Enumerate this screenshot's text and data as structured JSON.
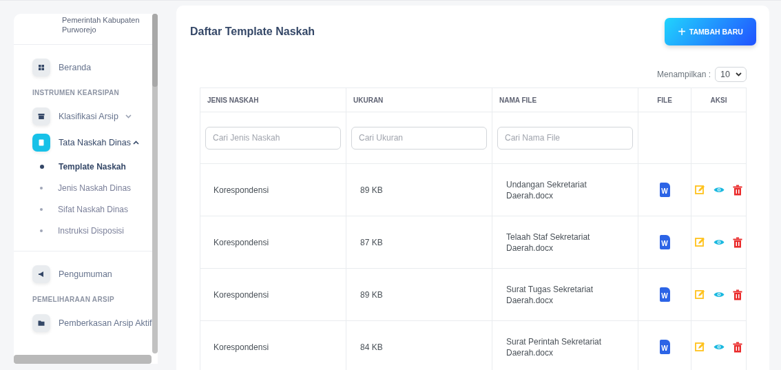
{
  "sidebar": {
    "org_name": [
      "Pemerintah Kabupaten",
      "Purworejo"
    ],
    "items": [
      {
        "kind": "link",
        "label": "Beranda",
        "selected": false
      },
      {
        "kind": "heading",
        "label": "INSTRUMEN KEARSIPAN"
      },
      {
        "kind": "group",
        "label": "Klasifikasi Arsip",
        "selected": false,
        "expanded": false
      },
      {
        "kind": "group",
        "label": "Tata Naskah Dinas",
        "selected": true,
        "expanded": true,
        "children": [
          {
            "label": "Template Naskah",
            "selected": true
          },
          {
            "label": "Jenis Naskah Dinas",
            "selected": false
          },
          {
            "label": "Sifat Naskah Dinas",
            "selected": false
          },
          {
            "label": "Instruksi Disposisi",
            "selected": false
          }
        ]
      },
      {
        "kind": "divider"
      },
      {
        "kind": "link",
        "label": "Pengumuman",
        "selected": false
      },
      {
        "kind": "heading",
        "label": "PEMELIHARAAN ARSIP"
      },
      {
        "kind": "link",
        "label": "Pemberkasan Arsip Aktif",
        "selected": false
      }
    ]
  },
  "page_title": "Daftar Template Naskah",
  "add_button": {
    "icon": "+",
    "label": "TAMBAH BARU"
  },
  "page_size": {
    "label": "Menampilkan :",
    "value": "10"
  },
  "table": {
    "columns": [
      "JENIS NASKAH",
      "UKURAN",
      "NAMA FILE",
      "FILE",
      "AKSI"
    ],
    "filters": [
      {
        "placeholder": "Cari Jenis Naskah"
      },
      {
        "placeholder": "Cari Ukuran"
      },
      {
        "placeholder": "Cari Nama File"
      }
    ],
    "rows": [
      {
        "jenis": "Korespondensi",
        "ukuran": "89 KB",
        "nama_file": "Undangan Sekretariat Daerah.docx",
        "file_mark": "W"
      },
      {
        "jenis": "Korespondensi",
        "ukuran": "87 KB",
        "nama_file": "Telaah Staf Sekretariat Daerah.docx",
        "file_mark": "W"
      },
      {
        "jenis": "Korespondensi",
        "ukuran": "89 KB",
        "nama_file": "Surat Tugas Sekretariat Daerah.docx",
        "file_mark": "W"
      },
      {
        "jenis": "Korespondensi",
        "ukuran": "84 KB",
        "nama_file": "Surat Perintah Sekretariat Daerah.docx",
        "file_mark": "W"
      }
    ]
  }
}
